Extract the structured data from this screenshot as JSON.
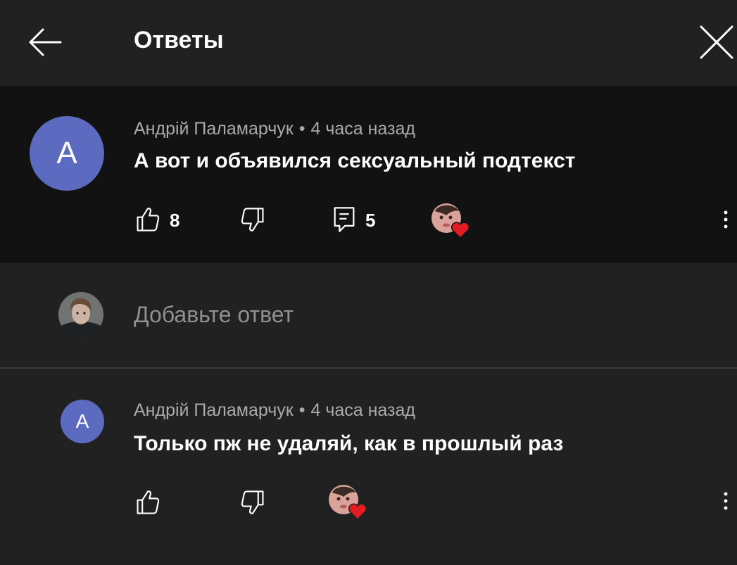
{
  "header": {
    "title": "Ответы",
    "back_icon": "arrow-left-icon",
    "close_icon": "close-icon"
  },
  "parent_comment": {
    "avatar_letter": "A",
    "author": "Андрій Паламарчук",
    "separator": "•",
    "time": "4 часа назад",
    "text": "А вот и объявился сексуальный подтекст",
    "likes": "8",
    "replies": "5"
  },
  "reply_box": {
    "placeholder": "Добавьте ответ"
  },
  "replies": [
    {
      "avatar_letter": "A",
      "author": "Андрій Паламарчук",
      "separator": "•",
      "time": "4 часа назад",
      "text": "Только пж не удаляй, как в прошлый раз"
    }
  ],
  "colors": {
    "avatar": "#5c6bc0",
    "heart": "#e31b23",
    "background": "#212121",
    "highlight": "#121212",
    "notification": "#e31b23"
  }
}
